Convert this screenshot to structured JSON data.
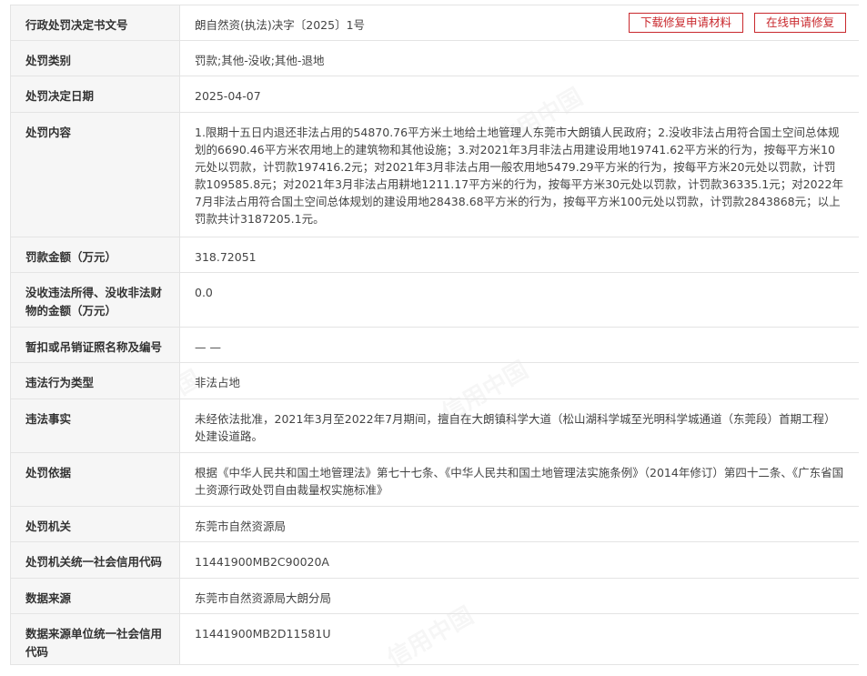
{
  "watermark": "信用中国",
  "rows": [
    {
      "label": "行政处罚决定书文号",
      "value": "朗自然资(执法)决字〔2025〕1号"
    },
    {
      "label": "处罚类别",
      "value": "罚款;其他-没收;其他-退地"
    },
    {
      "label": "处罚决定日期",
      "value": "2025-04-07"
    },
    {
      "label": "处罚内容",
      "value": "1.限期十五日内退还非法占用的54870.76平方米土地给土地管理人东莞市大朗镇人民政府；2.没收非法占用符合国土空间总体规划的6690.46平方米农用地上的建筑物和其他设施；3.对2021年3月非法占用建设用地19741.62平方米的行为，按每平方米10元处以罚款，计罚款197416.2元；对2021年3月非法占用一般农用地5479.29平方米的行为，按每平方米20元处以罚款，计罚款109585.8元；对2021年3月非法占用耕地1211.17平方米的行为，按每平方米30元处以罚款，计罚款36335.1元；对2022年7月非法占用符合国土空间总体规划的建设用地28438.68平方米的行为，按每平方米100元处以罚款，计罚款2843868元；以上罚款共计3187205.1元。"
    },
    {
      "label": "罚款金额（万元）",
      "value": "318.72051"
    },
    {
      "label": "没收违法所得、没收非法财物的金额（万元）",
      "value": "0.0"
    },
    {
      "label": "暂扣或吊销证照名称及编号",
      "value": "— —"
    },
    {
      "label": "违法行为类型",
      "value": "非法占地"
    },
    {
      "label": "违法事实",
      "value": "未经依法批准，2021年3月至2022年7月期间，擅自在大朗镇科学大道（松山湖科学城至光明科学城通道（东莞段）首期工程）处建设道路。"
    },
    {
      "label": "处罚依据",
      "value": "根据《中华人民共和国土地管理法》第七十七条、《中华人民共和国土地管理法实施条例》（2014年修订）第四十二条、《广东省国土资源行政处罚自由裁量权实施标准》"
    },
    {
      "label": "处罚机关",
      "value": "东莞市自然资源局"
    },
    {
      "label": "处罚机关统一社会信用代码",
      "value": "11441900MB2C90020A"
    },
    {
      "label": "数据来源",
      "value": "东莞市自然资源局大朗分局"
    },
    {
      "label": "数据来源单位统一社会信用代码",
      "value": "11441900MB2D11581U"
    }
  ],
  "buttons": {
    "download": "下载修复申请材料",
    "online": "在线申请修复"
  },
  "colors": {
    "accent": "#c9282d",
    "label_bg": "#f6f6f6",
    "border": "#e4e4e4"
  }
}
